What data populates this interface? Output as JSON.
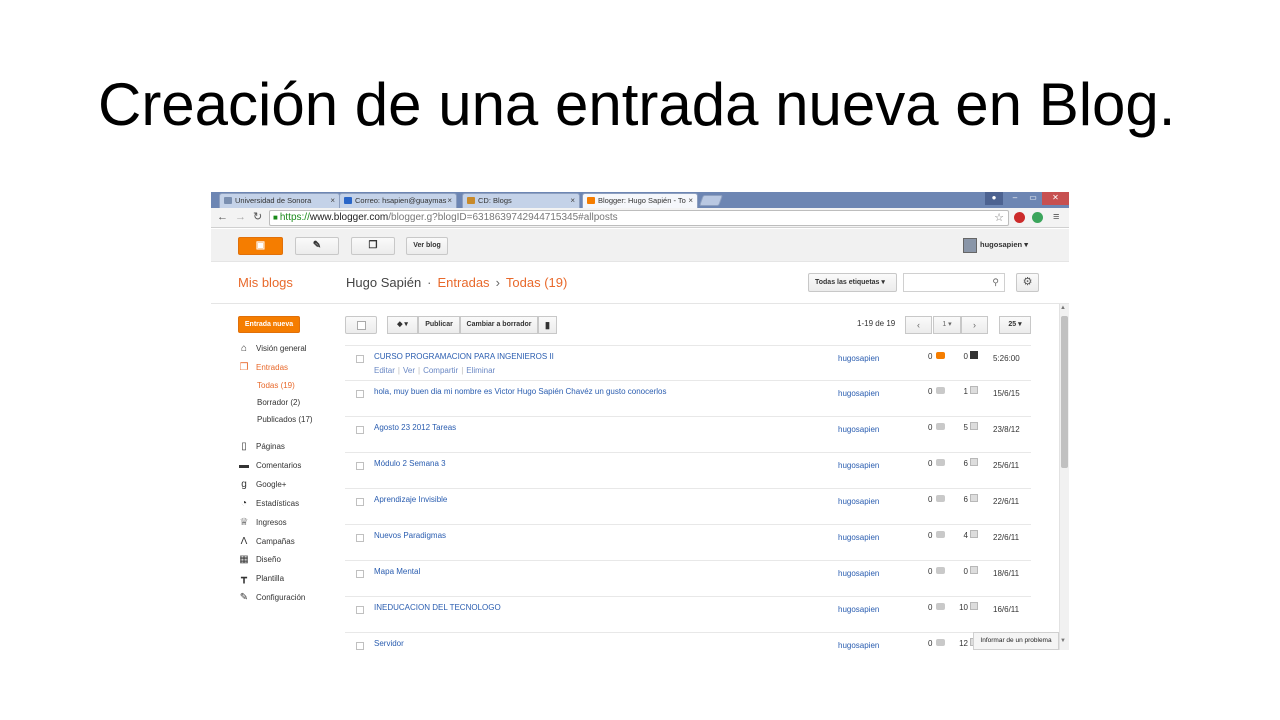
{
  "slide": {
    "title": "Creación de una entrada nueva en Blog."
  },
  "browser": {
    "tabs": [
      {
        "label": "Universidad de Sonora",
        "icon": "unison-favicon-icon",
        "color": "#7a8fb0"
      },
      {
        "label": "Correo: hsapien@guaymas",
        "icon": "mail-favicon-icon",
        "color": "#2a66c8"
      },
      {
        "label": "CD: Blogs",
        "icon": "cd-favicon-icon",
        "color": "#c88a2a"
      },
      {
        "label": "Blogger: Hugo Sapién - To",
        "icon": "blogger-favicon-icon",
        "color": "#f57d00"
      }
    ],
    "url": {
      "scheme": "https://",
      "host": "www.blogger.com",
      "path": "/blogger.g?blogID=6318639742944715345#allposts"
    },
    "win_controls": {
      "minimize": "–",
      "maximize": "▭",
      "close": "✕"
    }
  },
  "blogger_toolbar": {
    "view_blog": "Ver blog",
    "username": "hugosapien"
  },
  "header": {
    "mis_blogs": "Mis blogs",
    "blog_name": "Hugo Sapién",
    "sep1": "·",
    "section": "Entradas",
    "sep2": "›",
    "filter": "Todas (19)",
    "labels_dropdown": "Todas las etiquetas"
  },
  "sidebar": {
    "new_post": "Entrada nueva",
    "items": [
      {
        "label": "Visión general",
        "icon": "home-icon",
        "glyph": "⌂"
      },
      {
        "label": "Entradas",
        "icon": "posts-icon",
        "glyph": "❐"
      },
      {
        "label": "Páginas",
        "icon": "pages-icon",
        "glyph": "▯"
      },
      {
        "label": "Comentarios",
        "icon": "comments-icon",
        "glyph": "▬"
      },
      {
        "label": "Google+",
        "icon": "google-plus-icon",
        "glyph": "g"
      },
      {
        "label": "Estadísticas",
        "icon": "stats-icon",
        "glyph": "◔"
      },
      {
        "label": "Ingresos",
        "icon": "trophy-icon",
        "glyph": "♕"
      },
      {
        "label": "Campañas",
        "icon": "campaigns-icon",
        "glyph": "Λ"
      },
      {
        "label": "Diseño",
        "icon": "layout-icon",
        "glyph": "▦"
      },
      {
        "label": "Plantilla",
        "icon": "template-icon",
        "glyph": "┳"
      },
      {
        "label": "Configuración",
        "icon": "wrench-icon",
        "glyph": "✎"
      }
    ],
    "subitems": [
      {
        "label": "Todas (19)"
      },
      {
        "label": "Borrador (2)"
      },
      {
        "label": "Publicados (17)"
      }
    ]
  },
  "list_toolbar": {
    "publish": "Publicar",
    "to_draft": "Cambiar a borrador",
    "range": "1-19 de 19",
    "page": "1",
    "per_page": "25"
  },
  "posts": [
    {
      "title": "CURSO PROGRAMACION PARA INGENIEROS II",
      "author": "hugosapien",
      "comments": "0",
      "views": "0",
      "date": "5:26:00"
    },
    {
      "title": "hola, muy buen dia mi nombre es Victor Hugo Sapién Chavéz un gusto conocerlos",
      "author": "hugosapien",
      "comments": "0",
      "views": "1",
      "date": "15/6/15"
    },
    {
      "title": "Agosto 23 2012 Tareas",
      "author": "hugosapien",
      "comments": "0",
      "views": "5",
      "date": "23/8/12"
    },
    {
      "title": "Módulo 2 Semana 3",
      "author": "hugosapien",
      "comments": "0",
      "views": "6",
      "date": "25/6/11"
    },
    {
      "title": "Aprendizaje Invisible",
      "author": "hugosapien",
      "comments": "0",
      "views": "6",
      "date": "22/6/11"
    },
    {
      "title": "Nuevos Paradigmas",
      "author": "hugosapien",
      "comments": "0",
      "views": "4",
      "date": "22/6/11"
    },
    {
      "title": "Mapa Mental",
      "author": "hugosapien",
      "comments": "0",
      "views": "0",
      "date": "18/6/11"
    },
    {
      "title": "INEDUCACION DEL TECNOLOGO",
      "author": "hugosapien",
      "comments": "0",
      "views": "10",
      "date": "16/6/11"
    },
    {
      "title": "Servidor",
      "author": "hugosapien",
      "comments": "0",
      "views": "12",
      "date": ""
    }
  ],
  "post_actions": {
    "edit": "Editar",
    "view": "Ver",
    "share": "Compartir",
    "delete": "Eliminar"
  },
  "report": "Informar de un problema",
  "colors": {
    "accent": "#f57d00",
    "link": "#2a5db0",
    "nav_selected": "#e8692b"
  }
}
